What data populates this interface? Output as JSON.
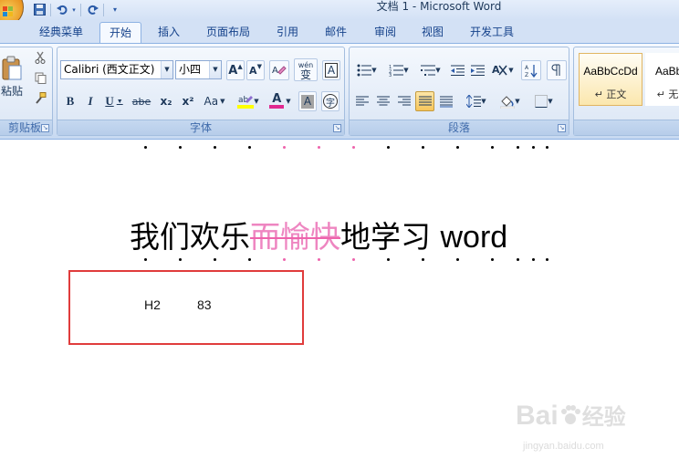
{
  "window": {
    "title": "文档 1 - Microsoft Word"
  },
  "quick_access": {
    "icons": [
      "save-icon",
      "undo-icon",
      "redo-icon",
      "customize-icon"
    ]
  },
  "tabs": [
    {
      "label": "经典菜单"
    },
    {
      "label": "开始"
    },
    {
      "label": "插入"
    },
    {
      "label": "页面布局"
    },
    {
      "label": "引用"
    },
    {
      "label": "邮件"
    },
    {
      "label": "审阅"
    },
    {
      "label": "视图"
    },
    {
      "label": "开发工具"
    }
  ],
  "active_tab": "开始",
  "ribbon": {
    "clipboard": {
      "label": "剪贴板",
      "paste_label": "粘贴"
    },
    "font": {
      "label": "字体",
      "font_name": "Calibri (西文正文)",
      "font_size": "小四",
      "bold": "B",
      "italic": "I",
      "underline": "U",
      "strikethrough": "abe",
      "subscript": "x₂",
      "superscript": "x²",
      "change_case": "Aa",
      "grow": "A",
      "shrink": "A",
      "phonetic": "wén",
      "phonetic_char": "变",
      "char_border": "A",
      "char_shading": "A",
      "enclose": "字"
    },
    "paragraph": {
      "label": "段落"
    },
    "styles": {
      "items": [
        {
          "sample": "AaBbCcDd",
          "name": "↵ 正文"
        },
        {
          "sample": "AaBbC",
          "name": "↵ 无间"
        }
      ]
    }
  },
  "document": {
    "text_before": "我们欢乐",
    "text_strike": "而愉快",
    "text_after": "地学习 ",
    "text_latin": "word"
  },
  "callout": {
    "left_value": "H2",
    "right_value": "83"
  },
  "watermark": {
    "brand": "Bai",
    "brand_end": "经验",
    "url": "jingyan.baidu.com"
  },
  "colors": {
    "accent_ribbon": "#15428b",
    "strike_text": "#ee86c1",
    "callout_border": "#e03c3c",
    "highlight_yellow": "#ffff00",
    "font_color_red": "#e0288f"
  }
}
